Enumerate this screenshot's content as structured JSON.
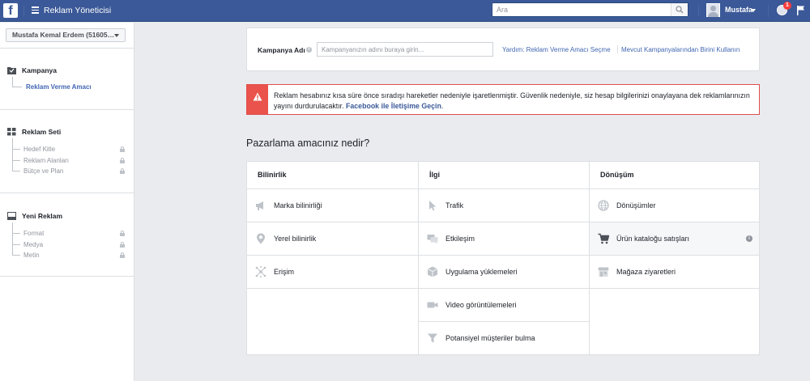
{
  "topbar": {
    "logo": "f",
    "app_title": "Reklam Yöneticisi",
    "search_placeholder": "Ara",
    "username": "Mustafa",
    "notification_count": "1",
    "colors": {
      "bar": "#3b5998"
    }
  },
  "sidebar": {
    "account": "Mustafa Kemal Erdem (51605…",
    "sections": [
      {
        "label": "Kampanya",
        "icon": "folder-icon",
        "items": [
          {
            "label": "Reklam Verme Amacı",
            "active": true,
            "locked": false
          }
        ]
      },
      {
        "label": "Reklam Seti",
        "icon": "grid-icon",
        "items": [
          {
            "label": "Hedef Kitle",
            "locked": true
          },
          {
            "label": "Reklam Alanları",
            "locked": true
          },
          {
            "label": "Bütçe ve Plan",
            "locked": true
          }
        ]
      },
      {
        "label": "Yeni Reklam",
        "icon": "ad-icon",
        "items": [
          {
            "label": "Format",
            "locked": true
          },
          {
            "label": "Medya",
            "locked": true
          },
          {
            "label": "Metin",
            "locked": true
          }
        ]
      }
    ]
  },
  "campaign": {
    "label": "Kampanya Adı",
    "placeholder": "Kampanyanızın adını buraya girin...",
    "help_link": "Yardım: Reklam Verme Amacı Seçme",
    "existing_link": "Mevcut Kampanyalarından Birini Kullanın"
  },
  "alert": {
    "text": "Reklam hesabınız kısa süre önce sıradışı hareketler nedeniyle işaretlenmiştir. Güvenlik nedeniyle, siz hesap bilgilerinizi onaylayana dek reklamlarınızın yayını durdurulacaktır.",
    "link": "Facebook ile İletişime Geçin",
    "suffix": "."
  },
  "objectives": {
    "question": "Pazarlama amacınız nedir?",
    "columns": [
      {
        "title": "Bilinirlik",
        "items": [
          {
            "label": "Marka bilinirliği",
            "icon": "megaphone-icon"
          },
          {
            "label": "Yerel bilinirlik",
            "icon": "location-pin-icon"
          },
          {
            "label": "Erişim",
            "icon": "reach-icon"
          }
        ]
      },
      {
        "title": "İlgi",
        "items": [
          {
            "label": "Trafik",
            "icon": "cursor-icon"
          },
          {
            "label": "Etkileşim",
            "icon": "chat-bubbles-icon"
          },
          {
            "label": "Uygulama yüklemeleri",
            "icon": "box-icon"
          },
          {
            "label": "Video görüntülemeleri",
            "icon": "video-camera-icon"
          },
          {
            "label": "Potansiyel müşteriler bulma",
            "icon": "funnel-icon"
          }
        ]
      },
      {
        "title": "Dönüşüm",
        "items": [
          {
            "label": "Dönüşümler",
            "icon": "globe-icon"
          },
          {
            "label": "Ürün kataloğu satışları",
            "icon": "cart-icon",
            "selected": true,
            "info": "i"
          },
          {
            "label": "Mağaza ziyaretleri",
            "icon": "store-icon"
          }
        ]
      }
    ]
  }
}
